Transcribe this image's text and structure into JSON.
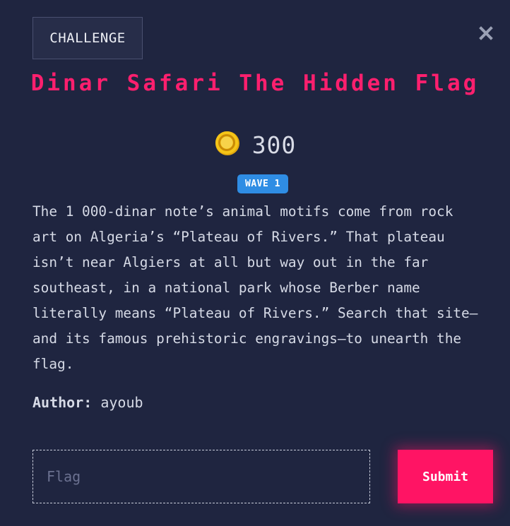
{
  "modal": {
    "tab_label": "CHALLENGE",
    "close_icon": "close-icon",
    "title": "Dinar Safari The Hidden Flag",
    "points_icon": "coin-icon",
    "points": "300",
    "badge": "WAVE 1",
    "description": "The 1 000-dinar note’s animal motifs come from rock\nart on Algeria’s “Plateau of Rivers.” That plateau\nisn’t near Algiers at all but way out in the far\nsoutheast, in a national park whose Berber name\nliterally means “Plateau of Rivers.” Search that site—\nand its famous prehistoric engravings—to unearth the\nflag.",
    "author_label": "Author:",
    "author_name": "ayoub",
    "flag_input": {
      "value": "",
      "placeholder": "Flag"
    },
    "submit_label": "Submit"
  },
  "colors": {
    "background": "#1f2540",
    "title": "#ff1f6e",
    "badge": "#2f8de4",
    "submit": "#ff1464",
    "coin": "#f5c518"
  }
}
